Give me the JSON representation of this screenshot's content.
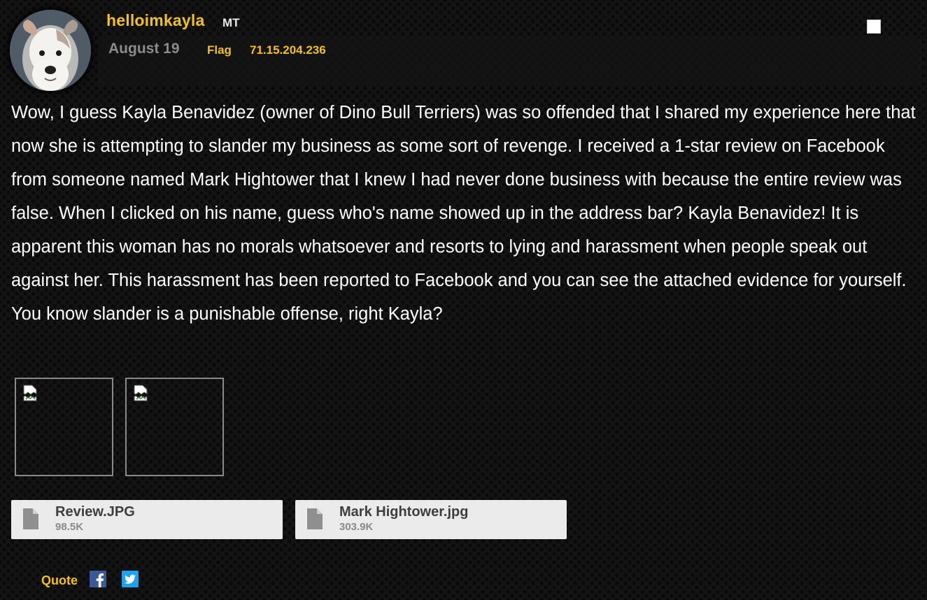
{
  "post": {
    "username": "helloimkayla",
    "user_badge": "MT",
    "date": "August 19",
    "flag_label": "Flag",
    "ip_address": "71.15.204.236",
    "avatar_icon": "dog-avatar",
    "body": "Wow, I guess Kayla Benavidez (owner of Dino Bull Terriers) was so offended that I shared my experience here that now she is attempting to slander my business as some sort of revenge. I received a 1-star review on Facebook from someone named Mark Hightower that I knew I had never done business with because the entire review was false. When I clicked on his name, guess who's name showed up in the address bar? Kayla Benavidez! It is apparent this woman has no morals whatsoever and resorts to lying and harassment when people speak out against her. This harassment has been reported to Facebook and you can see the attached evidence for yourself. You know slander is a punishable offense, right Kayla?",
    "thumbnails": [
      {
        "icon": "broken-image-icon"
      },
      {
        "icon": "broken-image-icon"
      }
    ],
    "attachments": [
      {
        "name": "Review.JPG",
        "size": "98.5K",
        "icon": "file-icon"
      },
      {
        "name": "Mark Hightower.jpg",
        "size": "303.9K",
        "icon": "file-icon"
      }
    ],
    "footer": {
      "quote_label": "Quote",
      "share_icons": [
        "facebook-icon",
        "twitter-icon"
      ]
    }
  },
  "colors": {
    "accent": "#f2c01f",
    "date_gray": "#8c8c8c",
    "background": "#141414",
    "attachment_bg": "#ebebeb",
    "facebook_blue": "#3b5998",
    "twitter_blue": "#1da1f2"
  }
}
